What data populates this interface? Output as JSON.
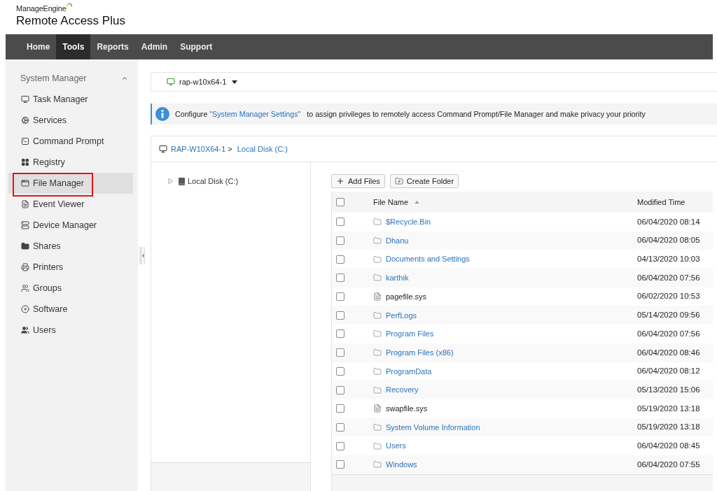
{
  "header": {
    "brand": "ManageEngine",
    "product": "Remote Access Plus"
  },
  "nav": [
    {
      "label": "Home",
      "selected": false
    },
    {
      "label": "Tools",
      "selected": true
    },
    {
      "label": "Reports",
      "selected": false
    },
    {
      "label": "Admin",
      "selected": false
    },
    {
      "label": "Support",
      "selected": false
    }
  ],
  "sidebar": {
    "section": "System Manager",
    "expanded": true,
    "items": [
      {
        "label": "Task Manager",
        "selected": false,
        "highlighted": false
      },
      {
        "label": "Services",
        "selected": false,
        "highlighted": false
      },
      {
        "label": "Command Prompt",
        "selected": false,
        "highlighted": false
      },
      {
        "label": "Registry",
        "selected": false,
        "highlighted": false
      },
      {
        "label": "File Manager",
        "selected": true,
        "highlighted": true
      },
      {
        "label": "Event Viewer",
        "selected": false,
        "highlighted": false
      },
      {
        "label": "Device Manager",
        "selected": false,
        "highlighted": false
      },
      {
        "label": "Shares",
        "selected": false,
        "highlighted": false
      },
      {
        "label": "Printers",
        "selected": false,
        "highlighted": false
      },
      {
        "label": "Groups",
        "selected": false,
        "highlighted": false
      },
      {
        "label": "Software",
        "selected": false,
        "highlighted": false
      },
      {
        "label": "Users",
        "selected": false,
        "highlighted": false
      }
    ]
  },
  "device_selector": {
    "value": "rap-w10x64-1"
  },
  "banner": {
    "text_before": "Configure",
    "link": "\"System Manager Settings\"",
    "text_after": "to assign privileges to remotely access Command Prompt/File Manager and make privacy your priority"
  },
  "breadcrumb": {
    "items": [
      {
        "label": "RAP-W10X64-1"
      },
      {
        "label": "Local Disk (C:)"
      }
    ],
    "separator": ">"
  },
  "tree": [
    {
      "label": "Local Disk (C:)",
      "expanded": false
    }
  ],
  "toolbar": [
    {
      "kind": "add",
      "label": "Add Files"
    },
    {
      "kind": "create_folder",
      "label": "Create Folder"
    }
  ],
  "table": {
    "all_checked": false,
    "columns": [
      {
        "label": "File Name",
        "sorted": true,
        "ascending": true
      },
      {
        "label": "Modified Time",
        "sorted": false
      }
    ],
    "rows": [
      {
        "kind": "folder",
        "name": "$Recycle.Bin",
        "modified": "06/04/2020 08:14",
        "checked": false
      },
      {
        "kind": "folder",
        "name": "Dhanu",
        "modified": "06/04/2020 08:05",
        "checked": false
      },
      {
        "kind": "folder",
        "name": "Documents and Settings",
        "modified": "04/13/2020 10:03",
        "checked": false
      },
      {
        "kind": "folder",
        "name": "karthik",
        "modified": "06/04/2020 07:56",
        "checked": false
      },
      {
        "kind": "file",
        "name": "pagefile.sys",
        "modified": "06/02/2020 10:53",
        "checked": false
      },
      {
        "kind": "folder",
        "name": "PerfLogs",
        "modified": "05/14/2020 09:56",
        "checked": false
      },
      {
        "kind": "folder",
        "name": "Program Files",
        "modified": "06/04/2020 07:56",
        "checked": false
      },
      {
        "kind": "folder",
        "name": "Program Files (x86)",
        "modified": "06/04/2020 08:46",
        "checked": false
      },
      {
        "kind": "folder",
        "name": "ProgramData",
        "modified": "06/04/2020 08:12",
        "checked": false
      },
      {
        "kind": "folder",
        "name": "Recovery",
        "modified": "05/13/2020 15:06",
        "checked": false
      },
      {
        "kind": "file",
        "name": "swapfile.sys",
        "modified": "05/19/2020 13:18",
        "checked": false
      },
      {
        "kind": "folder",
        "name": "System Volume Information",
        "modified": "05/19/2020 13:18",
        "checked": false
      },
      {
        "kind": "folder",
        "name": "Users",
        "modified": "06/04/2020 08:45",
        "checked": false
      },
      {
        "kind": "folder",
        "name": "Windows",
        "modified": "06/04/2020 07:55",
        "checked": false
      }
    ]
  }
}
